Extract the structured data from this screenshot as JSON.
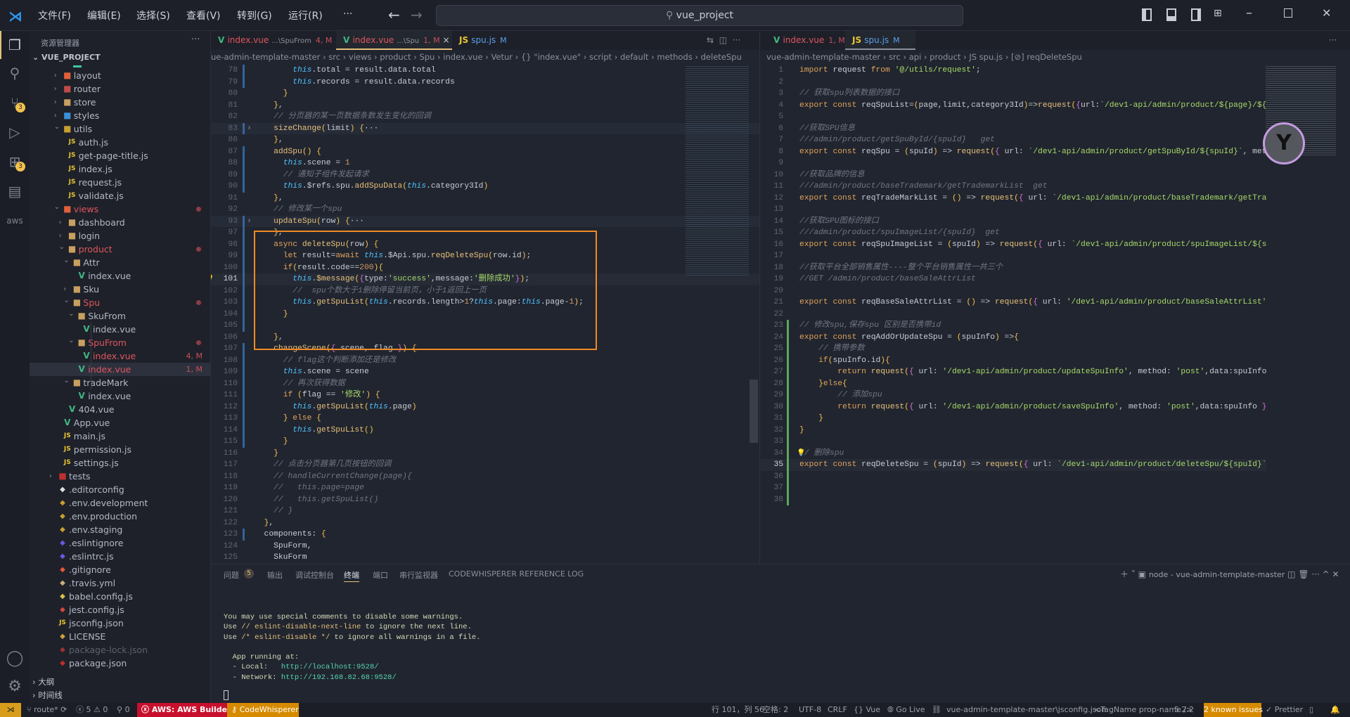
{
  "titlebar": {
    "menu": [
      "文件(F)",
      "编辑(E)",
      "选择(S)",
      "查看(V)",
      "转到(G)",
      "运行(R)",
      "···"
    ],
    "search": "vue_project"
  },
  "activity": {
    "scm_badge": "3",
    "extensions_badge": "3"
  },
  "sidebar": {
    "title": "资源管理器",
    "more": "···",
    "project": "VUE_PROJECT",
    "tree": [
      {
        "label": "layout",
        "depth": 1,
        "kind": "folder",
        "icon": "layout-folder-icon",
        "iconColor": "#e0603a"
      },
      {
        "label": "router",
        "depth": 1,
        "kind": "folder",
        "icon": "router-folder-icon",
        "iconColor": "#c04a4a"
      },
      {
        "label": "store",
        "depth": 1,
        "kind": "folder",
        "icon": "folder-icon",
        "iconColor": "#c8a060"
      },
      {
        "label": "styles",
        "depth": 1,
        "kind": "folder",
        "icon": "styles-folder-icon",
        "iconColor": "#3a8fd8"
      },
      {
        "label": "utils",
        "depth": 1,
        "kind": "folder",
        "open": true,
        "icon": "utils-folder-icon",
        "iconColor": "#c8a030"
      },
      {
        "label": "auth.js",
        "depth": 2,
        "kind": "js"
      },
      {
        "label": "get-page-title.js",
        "depth": 2,
        "kind": "js"
      },
      {
        "label": "index.js",
        "depth": 2,
        "kind": "js"
      },
      {
        "label": "request.js",
        "depth": 2,
        "kind": "js"
      },
      {
        "label": "validate.js",
        "depth": 2,
        "kind": "js"
      },
      {
        "label": "views",
        "depth": 1,
        "kind": "folder",
        "open": true,
        "modified": true,
        "dot": true,
        "icon": "views-folder-icon",
        "iconColor": "#e0603a"
      },
      {
        "label": "dashboard",
        "depth": 2,
        "kind": "folder"
      },
      {
        "label": "login",
        "depth": 2,
        "kind": "folder"
      },
      {
        "label": "product",
        "depth": 2,
        "kind": "folder",
        "open": true,
        "modified": true,
        "dot": true
      },
      {
        "label": "Attr",
        "depth": 3,
        "kind": "folder",
        "open": true
      },
      {
        "label": "index.vue",
        "depth": 4,
        "kind": "vue"
      },
      {
        "label": "Sku",
        "depth": 3,
        "kind": "folder"
      },
      {
        "label": "Spu",
        "depth": 3,
        "kind": "folder",
        "open": true,
        "modified": true,
        "dot": true
      },
      {
        "label": "SkuFrom",
        "depth": 4,
        "kind": "folder",
        "open": true
      },
      {
        "label": "index.vue",
        "depth": 5,
        "kind": "vue"
      },
      {
        "label": "SpuFrom",
        "depth": 4,
        "kind": "folder",
        "open": true,
        "modified": true,
        "dot": true
      },
      {
        "label": "index.vue",
        "depth": 5,
        "kind": "vue",
        "modified": true,
        "status": "4, M"
      },
      {
        "label": "index.vue",
        "depth": 4,
        "kind": "vue",
        "modified": true,
        "status": "1, M",
        "selected": true
      },
      {
        "label": "tradeMark",
        "depth": 3,
        "kind": "folder",
        "open": true
      },
      {
        "label": "index.vue",
        "depth": 4,
        "kind": "vue"
      },
      {
        "label": "404.vue",
        "depth": 2,
        "kind": "vue"
      },
      {
        "label": "App.vue",
        "depth": 1,
        "kind": "vue"
      },
      {
        "label": "main.js",
        "depth": 1,
        "kind": "js"
      },
      {
        "label": "permission.js",
        "depth": 1,
        "kind": "js"
      },
      {
        "label": "settings.js",
        "depth": 1,
        "kind": "js"
      },
      {
        "label": "tests",
        "depth": 0,
        "kind": "folder",
        "icon": "tests-folder-icon",
        "iconColor": "#c03030"
      },
      {
        "label": ".editorconfig",
        "depth": 0,
        "kind": "file",
        "icon": "editorconfig-icon",
        "iconColor": "#e0e0e0"
      },
      {
        "label": ".env.development",
        "depth": 0,
        "kind": "file",
        "icon": "terminal-file-icon",
        "iconColor": "#c8a030"
      },
      {
        "label": ".env.production",
        "depth": 0,
        "kind": "file",
        "icon": "terminal-file-icon",
        "iconColor": "#c8a030"
      },
      {
        "label": ".env.staging",
        "depth": 0,
        "kind": "file",
        "icon": "terminal-file-icon",
        "iconColor": "#c8a030"
      },
      {
        "label": ".eslintignore",
        "depth": 0,
        "kind": "file",
        "icon": "eslint-icon",
        "iconColor": "#6a5ae0"
      },
      {
        "label": ".eslintrc.js",
        "depth": 0,
        "kind": "file",
        "icon": "eslint-icon",
        "iconColor": "#6a5ae0"
      },
      {
        "label": ".gitignore",
        "depth": 0,
        "kind": "file",
        "icon": "git-icon",
        "iconColor": "#e05a3a"
      },
      {
        "label": ".travis.yml",
        "depth": 0,
        "kind": "file",
        "icon": "travis-icon",
        "iconColor": "#c8b080"
      },
      {
        "label": "babel.config.js",
        "depth": 0,
        "kind": "file",
        "icon": "babel-icon",
        "iconColor": "#d8c050"
      },
      {
        "label": "jest.config.js",
        "depth": 0,
        "kind": "file",
        "icon": "jest-icon",
        "iconColor": "#d04a3a"
      },
      {
        "label": "jsconfig.json",
        "depth": 0,
        "kind": "js"
      },
      {
        "label": "LICENSE",
        "depth": 0,
        "kind": "file",
        "icon": "license-icon",
        "iconColor": "#d0a040"
      },
      {
        "label": "package-lock.json",
        "depth": 0,
        "kind": "file",
        "icon": "npm-icon",
        "iconColor": "#a03030",
        "ignored": true
      },
      {
        "label": "package.json",
        "depth": 0,
        "kind": "file",
        "icon": "npm-icon",
        "iconColor": "#c03030"
      }
    ],
    "outline": "大纲",
    "timeline": "时间线"
  },
  "left_editor": {
    "tabs": [
      {
        "label": "index.vue",
        "path": "...\\SpuFrom",
        "status": "4, M",
        "kind": "vue"
      },
      {
        "label": "index.vue",
        "path": "...\\Spu",
        "status": "1, M",
        "kind": "vue",
        "active": true
      },
      {
        "label": "spu.js",
        "path": "",
        "status": "M",
        "kind": "js"
      }
    ],
    "breadcrumb": "ue-admin-template-master › src › views › product › Spu › index.vue › Vetur › {} \"index.vue\" › script › default › methods › deleteSpu",
    "lines": [
      {
        "n": 78,
        "t": "        this.total = result.data.total",
        "g": "m"
      },
      {
        "n": 79,
        "t": "        this.records = result.data.records",
        "g": "m"
      },
      {
        "n": 80,
        "t": "      }"
      },
      {
        "n": 81,
        "t": "    },"
      },
      {
        "n": 82,
        "t": "    // 分页器的某一页数据条数发生变化的回调"
      },
      {
        "n": 83,
        "t": "    sizeChange(limit) {···",
        "fold": true,
        "g": "m"
      },
      {
        "n": 86,
        "t": "    },"
      },
      {
        "n": 87,
        "t": "    addSpu() {",
        "g": "m"
      },
      {
        "n": 88,
        "t": "      this.scene = 1",
        "g": "m"
      },
      {
        "n": 89,
        "t": "      // 通知子组件发起请求",
        "g": "m"
      },
      {
        "n": 90,
        "t": "      this.$refs.spu.addSpuData(this.category3Id)",
        "g": "m"
      },
      {
        "n": 91,
        "t": "    },"
      },
      {
        "n": 92,
        "t": "    // 修改某一个spu"
      },
      {
        "n": 93,
        "t": "    updateSpu(row) {···",
        "fold": true,
        "g": "m"
      },
      {
        "n": 97,
        "t": "    },",
        "g": "m"
      },
      {
        "n": 98,
        "t": "    async deleteSpu(row) {",
        "g": "m"
      },
      {
        "n": 99,
        "t": "      let result=await this.$Api.spu.reqDeleteSpu(row.id);",
        "g": "m"
      },
      {
        "n": 100,
        "t": "      if(result.code==200){",
        "g": "m"
      },
      {
        "n": 101,
        "t": "        this.$message({type:'success',message:'删除成功'});",
        "cur": true,
        "bulb": true,
        "g": "m"
      },
      {
        "n": 102,
        "t": "        //  spu个数大于1删除停留当前页，小于1返回上一页",
        "g": "m"
      },
      {
        "n": 103,
        "t": "        this.getSpuList(this.records.length>1?this.page:this.page-1);",
        "g": "m"
      },
      {
        "n": 104,
        "t": "      }",
        "g": "m"
      },
      {
        "n": 105,
        "t": "",
        "g": "m"
      },
      {
        "n": 106,
        "t": "    },"
      },
      {
        "n": 107,
        "t": "    changeScene({ scene, flag }) {",
        "g": "m"
      },
      {
        "n": 108,
        "t": "      // flag这个判断添加还是修改",
        "g": "m"
      },
      {
        "n": 109,
        "t": "      this.scene = scene",
        "g": "m"
      },
      {
        "n": 110,
        "t": "      // 再次获得数据",
        "g": "m"
      },
      {
        "n": 111,
        "t": "      if (flag == '修改') {",
        "g": "m"
      },
      {
        "n": 112,
        "t": "        this.getSpuList(this.page)",
        "g": "m"
      },
      {
        "n": 113,
        "t": "      } else {",
        "g": "m"
      },
      {
        "n": 114,
        "t": "        this.getSpuList()",
        "g": "m"
      },
      {
        "n": 115,
        "t": "      }",
        "g": "m"
      },
      {
        "n": 116,
        "t": "    }"
      },
      {
        "n": 117,
        "t": "    // 点击分页器第几页按钮的回调"
      },
      {
        "n": 118,
        "t": "    // handleCurrentChange(page){"
      },
      {
        "n": 119,
        "t": "    //   this.page=page"
      },
      {
        "n": 120,
        "t": "    //   this.getSpuList()"
      },
      {
        "n": 121,
        "t": "    // }"
      },
      {
        "n": 122,
        "t": "  },"
      },
      {
        "n": 123,
        "t": "  components: {",
        "g": "m"
      },
      {
        "n": 124,
        "t": "    SpuForm,"
      },
      {
        "n": 125,
        "t": "    SkuForm"
      }
    ]
  },
  "right_editor": {
    "tabs": [
      {
        "label": "index.vue",
        "path": "",
        "status": "1, M",
        "kind": "vue"
      },
      {
        "label": "spu.js",
        "path": "",
        "status": "M",
        "kind": "js",
        "active": true
      }
    ],
    "breadcrumb": "vue-admin-template-master › src › api › product › JS spu.js › [⊘] reqDeleteSpu",
    "lines": [
      {
        "n": 1,
        "t": "import request from '@/utils/request';"
      },
      {
        "n": 2,
        "t": ""
      },
      {
        "n": 3,
        "t": "// 获取spu列表数据的接口"
      },
      {
        "n": 4,
        "t": "export const reqSpuList=(page,limit,category3Id)=>request({url:`/dev1-api/admin/product/${page}/${l"
      },
      {
        "n": 5,
        "t": ""
      },
      {
        "n": 6,
        "t": "//获取SPU信息"
      },
      {
        "n": 7,
        "t": "///admin/product/getSpuById/{spuId}   get"
      },
      {
        "n": 8,
        "t": "export const reqSpu = (spuId) => request({ url: `/dev1-api/admin/product/getSpuById/${spuId}`, meth"
      },
      {
        "n": 9,
        "t": ""
      },
      {
        "n": 10,
        "t": "//获取品牌的信息"
      },
      {
        "n": 11,
        "t": "///admin/product/baseTrademark/getTrademarkList  get"
      },
      {
        "n": 12,
        "t": "export const reqTradeMarkList = () => request({ url: `/dev1-api/admin/product/baseTrademark/getTrad"
      },
      {
        "n": 13,
        "t": ""
      },
      {
        "n": 14,
        "t": "//获取SPU图标的接口"
      },
      {
        "n": 15,
        "t": "///admin/product/spuImageList/{spuId}  get"
      },
      {
        "n": 16,
        "t": "export const reqSpuImageList = (spuId) => request({ url: `/dev1-api/admin/product/spuImageList/${sp"
      },
      {
        "n": 17,
        "t": ""
      },
      {
        "n": 18,
        "t": "//获取平台全部销售属性----整个平台销售属性一共三个"
      },
      {
        "n": 19,
        "t": "//GET /admin/product/baseSaleAttrList"
      },
      {
        "n": 20,
        "t": ""
      },
      {
        "n": 21,
        "t": "export const reqBaseSaleAttrList = () => request({ url: '/dev1-api/admin/product/baseSaleAttrList',"
      },
      {
        "n": 22,
        "t": ""
      },
      {
        "n": 23,
        "t": "// 修改spu,保存spu 区别是否携带id",
        "g": "a"
      },
      {
        "n": 24,
        "t": "export const reqAddOrUpdateSpu = (spuInfo) =>{",
        "g": "a"
      },
      {
        "n": 25,
        "t": "    // 携带参数",
        "g": "a"
      },
      {
        "n": 26,
        "t": "    if(spuInfo.id){",
        "g": "a"
      },
      {
        "n": 27,
        "t": "        return request({ url: '/dev1-api/admin/product/updateSpuInfo', method: 'post',data:spuInfo",
        "g": "a"
      },
      {
        "n": 28,
        "t": "    }else{",
        "g": "a"
      },
      {
        "n": 29,
        "t": "        // 添加spu",
        "g": "a"
      },
      {
        "n": 30,
        "t": "        return request({ url: '/dev1-api/admin/product/saveSpuInfo', method: 'post',data:spuInfo })",
        "g": "a"
      },
      {
        "n": 31,
        "t": "    }",
        "g": "a"
      },
      {
        "n": 32,
        "t": "}",
        "g": "a"
      },
      {
        "n": 33,
        "t": "",
        "g": "a"
      },
      {
        "n": 34,
        "t": "// 删除spu",
        "g": "a",
        "bulb": true
      },
      {
        "n": 35,
        "t": "export const reqDeleteSpu = (spuId) => request({ url: `/dev1-api/admin/product/deleteSpu/${spuId}`,",
        "g": "a",
        "cur": true
      },
      {
        "n": 36,
        "t": "",
        "g": "a"
      },
      {
        "n": 37,
        "t": "",
        "g": "a"
      },
      {
        "n": 38,
        "t": "",
        "g": "a"
      }
    ]
  },
  "panel": {
    "tabs": [
      "问题",
      "输出",
      "调试控制台",
      "终端",
      "端口",
      "串行监视器",
      "CODEWHISPERER REFERENCE LOG"
    ],
    "problems_count": "5",
    "active_tab": "终端",
    "terminal_name": "node - vue-admin-template-master",
    "terminal": [
      [
        [
          "p",
          "You may use special comments to disable some warnings."
        ]
      ],
      [
        [
          "p",
          "Use "
        ],
        [
          "y",
          "// eslint-disable-next-line"
        ],
        [
          "p",
          " to ignore the next line."
        ]
      ],
      [
        [
          "p",
          "Use "
        ],
        [
          "y",
          "/* eslint-disable */"
        ],
        [
          "p",
          " to ignore all warnings in a file."
        ]
      ],
      [],
      [
        [
          "p",
          "  App running at:"
        ]
      ],
      [
        [
          "p",
          "  - Local:   "
        ],
        [
          "u",
          "http://localhost:9528/"
        ]
      ],
      [
        [
          "p",
          "  - Network: "
        ],
        [
          "u",
          "http://192.168.82.68:9528/"
        ]
      ]
    ]
  },
  "statusbar": {
    "branch": "route*",
    "errors": "5",
    "warnings": "0",
    "ports": "0",
    "aws": "AWS: AWS Builder ID",
    "codewhisperer": "CodeWhisperer",
    "position": "行 101，列 56",
    "spaces": "空格: 2",
    "encoding": "UTF-8",
    "eol": "CRLF",
    "language": "Vue",
    "golive": "Go Live",
    "jsconfig": "vue-admin-template-master\\jsconfig.json",
    "tagname": "<TagName prop-name />",
    "version": "5.2.2",
    "issues": "2 known issues",
    "prettier": "Prettier"
  },
  "colors": {
    "accent_yellow": "#e5c07b",
    "selection_box": "#f08a24",
    "aws_red": "#c8102e",
    "codewhisperer_orange": "#d68a00",
    "modified_red": "#e06c75"
  }
}
